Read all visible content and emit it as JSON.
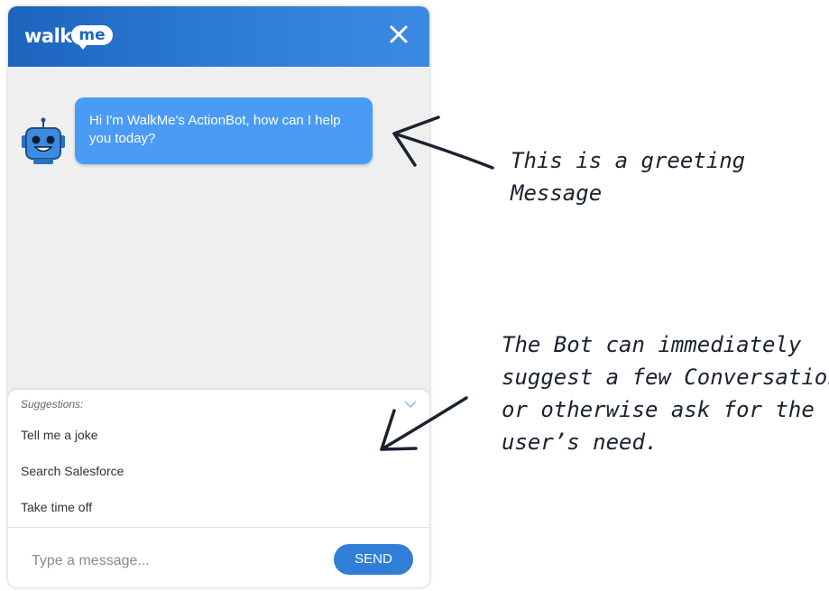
{
  "header": {
    "logo_text": "walk",
    "logo_badge": "me",
    "close_icon": "close-icon"
  },
  "chat": {
    "bot_avatar_icon": "robot-icon",
    "greeting": "Hi I'm WalkMe's ActionBot, how can I help you today?"
  },
  "suggestions": {
    "title": "Suggestions:",
    "collapse_icon": "chevron-down-icon",
    "items": [
      {
        "label": "Tell me a joke"
      },
      {
        "label": "Search Salesforce"
      },
      {
        "label": "Take time off"
      }
    ]
  },
  "composer": {
    "placeholder": "Type a message...",
    "send_label": "SEND"
  },
  "annotations": {
    "greeting_note": "This is a greeting\nMessage",
    "suggestions_note": "The Bot can immediately\nsuggest a few Conversations,\nor otherwise ask for the\nuser’s need."
  },
  "colors": {
    "header_start": "#1d64bd",
    "header_end": "#3b8ae3",
    "bubble": "#4a9bf5",
    "send_button": "#2f7fd8",
    "background": "#efefef"
  }
}
